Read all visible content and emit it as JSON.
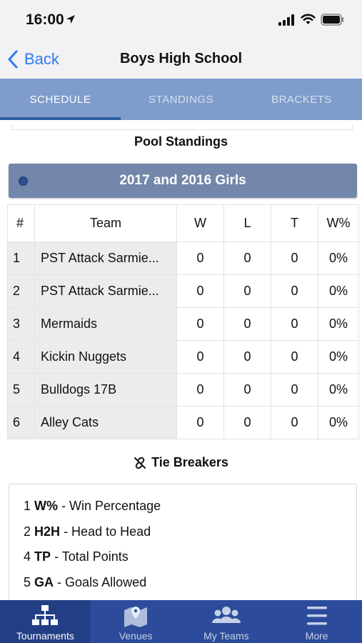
{
  "status_bar": {
    "time": "16:00"
  },
  "nav": {
    "back_label": "Back",
    "title": "Boys High School"
  },
  "tabs": [
    {
      "label": "SCHEDULE",
      "active": true
    },
    {
      "label": "STANDINGS",
      "active": false
    },
    {
      "label": "BRACKETS",
      "active": false
    }
  ],
  "pool": {
    "section_title": "Pool Standings",
    "group_name": "2017 and 2016 Girls",
    "columns": [
      "#",
      "Team",
      "W",
      "L",
      "T",
      "W%"
    ],
    "rows": [
      {
        "rank": "1",
        "team": "PST Attack Sarmie...",
        "w": "0",
        "l": "0",
        "t": "0",
        "pct": "0%"
      },
      {
        "rank": "2",
        "team": "PST Attack Sarmie...",
        "w": "0",
        "l": "0",
        "t": "0",
        "pct": "0%"
      },
      {
        "rank": "3",
        "team": "Mermaids",
        "w": "0",
        "l": "0",
        "t": "0",
        "pct": "0%"
      },
      {
        "rank": "4",
        "team": "Kickin Nuggets",
        "w": "0",
        "l": "0",
        "t": "0",
        "pct": "0%"
      },
      {
        "rank": "5",
        "team": "Bulldogs 17B",
        "w": "0",
        "l": "0",
        "t": "0",
        "pct": "0%"
      },
      {
        "rank": "6",
        "team": "Alley Cats",
        "w": "0",
        "l": "0",
        "t": "0",
        "pct": "0%"
      }
    ]
  },
  "tie_breakers": {
    "title": "Tie Breakers",
    "items": [
      {
        "num": "1",
        "code": "W%",
        "desc": "- Win Percentage"
      },
      {
        "num": "2",
        "code": "H2H",
        "desc": "- Head to Head"
      },
      {
        "num": "4",
        "code": "TP",
        "desc": "- Total Points"
      },
      {
        "num": "5",
        "code": "GA",
        "desc": "- Goals Allowed"
      }
    ]
  },
  "bottom_nav": [
    {
      "label": "Tournaments",
      "icon": "tournament-bracket-icon",
      "active": true
    },
    {
      "label": "Venues",
      "icon": "map-pin-icon",
      "active": false
    },
    {
      "label": "My Teams",
      "icon": "group-icon",
      "active": false
    },
    {
      "label": "More",
      "icon": "hamburger-menu-icon",
      "active": false
    }
  ],
  "colors": {
    "tab_bar": "#7f9ccb",
    "pool_header": "#7287aa",
    "bottom_bar": "#2c4c9b",
    "link_blue": "#2f7bf0"
  }
}
